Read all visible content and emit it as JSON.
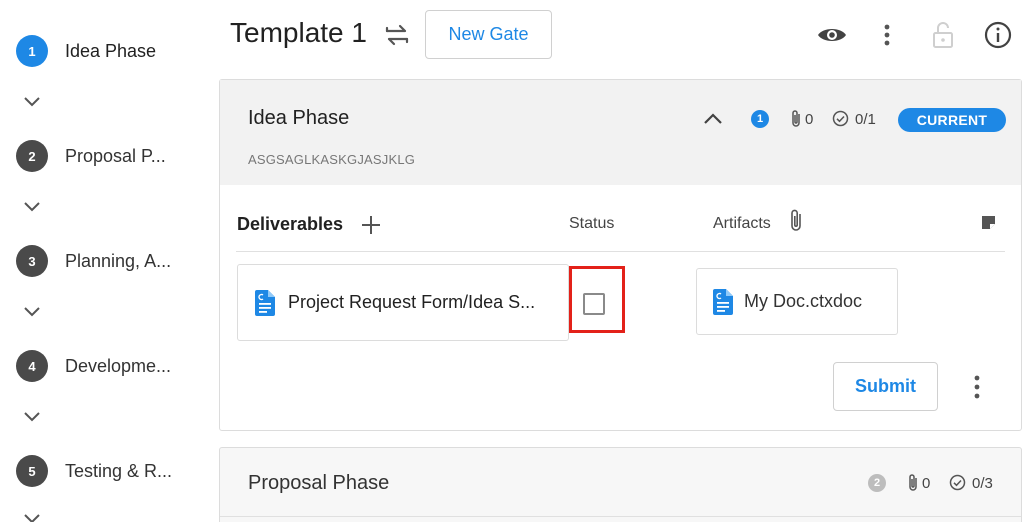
{
  "sidebar": {
    "steps": [
      {
        "num": "1",
        "label": "Idea Phase"
      },
      {
        "num": "2",
        "label": "Proposal P..."
      },
      {
        "num": "3",
        "label": "Planning, A..."
      },
      {
        "num": "4",
        "label": "Developme..."
      },
      {
        "num": "5",
        "label": "Testing & R..."
      }
    ]
  },
  "header": {
    "title": "Template 1",
    "new_gate_label": "New Gate"
  },
  "current_phase": {
    "title": "Idea Phase",
    "subtitle": "ASGSAGLKASKGJASJKLG",
    "step_badge": "1",
    "attachments_count": "0",
    "checks_count": "0/1",
    "status_badge": "CURRENT",
    "columns": {
      "deliverables": "Deliverables",
      "status": "Status",
      "artifacts": "Artifacts"
    },
    "deliverable": {
      "name": "Project Request Form/Idea S..."
    },
    "artifact": {
      "name": "My Doc.ctxdoc"
    },
    "submit_label": "Submit"
  },
  "next_phase": {
    "title": "Proposal Phase",
    "step_badge": "2",
    "attachments_count": "0",
    "checks_count": "0/3"
  },
  "colors": {
    "accent": "#1e88e5",
    "highlight": "#e32119",
    "step_inactive": "#4a4a4a"
  }
}
